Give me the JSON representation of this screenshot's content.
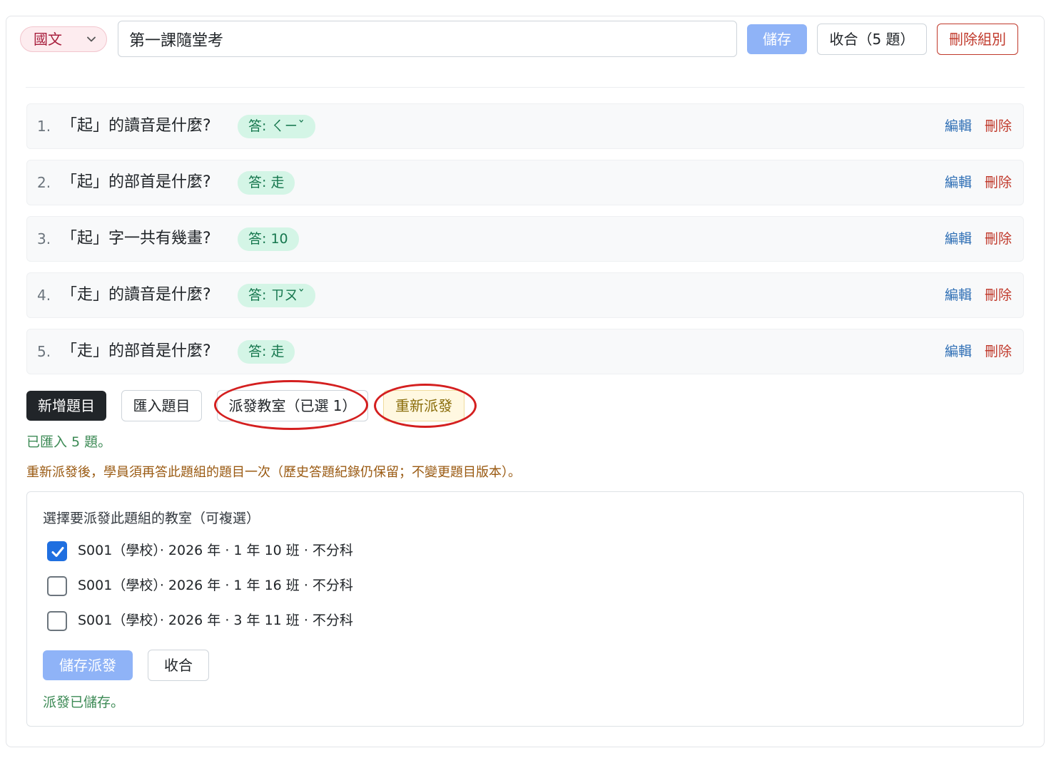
{
  "header": {
    "subject": "國文",
    "quiz_title": "第一課隨堂考",
    "save_label": "儲存",
    "collapse_label": "收合（5 題）",
    "delete_group_label": "刪除組別"
  },
  "questions": [
    {
      "num": "1.",
      "text": "「起」的讀音是什麼?",
      "answer": "答: ㄑㄧˇ"
    },
    {
      "num": "2.",
      "text": "「起」的部首是什麼?",
      "answer": "答: 走"
    },
    {
      "num": "3.",
      "text": "「起」字一共有幾畫?",
      "answer": "答: 10"
    },
    {
      "num": "4.",
      "text": "「走」的讀音是什麼?",
      "answer": "答: ㄗㄡˇ"
    },
    {
      "num": "5.",
      "text": "「走」的部首是什麼?",
      "answer": "答: 走"
    }
  ],
  "row_actions": {
    "edit": "編輯",
    "delete": "刪除"
  },
  "actions": {
    "add_question": "新增題目",
    "import_questions": "匯入題目",
    "dispatch_classroom": "派發教室（已選 1）",
    "redispatch": "重新派發"
  },
  "messages": {
    "imported": "已匯入 5 題。",
    "redispatch_warning": "重新派發後，學員須再答此題組的題目一次（歷史答題紀錄仍保留；不變更題目版本）。"
  },
  "dispatch_panel": {
    "title": "選擇要派發此題組的教室（可複選）",
    "classes": [
      {
        "label": "S001（學校）· 2026 年 · 1 年 10 班 · 不分科",
        "checked": true
      },
      {
        "label": "S001（學校）· 2026 年 · 1 年 16 班 · 不分科",
        "checked": false
      },
      {
        "label": "S001（學校）· 2026 年 · 3 年 11 班 · 不分科",
        "checked": false
      }
    ],
    "save_label": "儲存派發",
    "collapse_label": "收合",
    "saved_message": "派發已儲存。"
  },
  "colors": {
    "primary_disabled": "#8fb3f7",
    "danger": "#c0392b",
    "answer_badge_bg": "#d4f5e6",
    "annotation_red": "#d41f1f"
  }
}
